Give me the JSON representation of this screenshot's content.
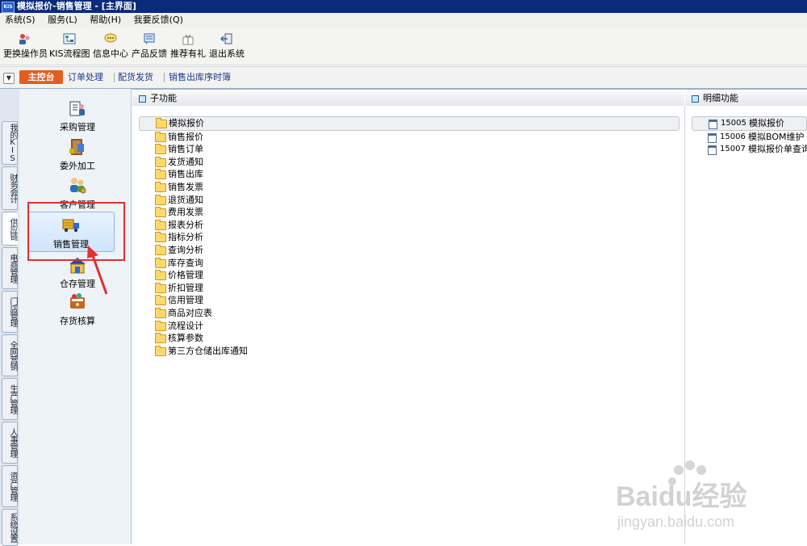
{
  "window": {
    "title": "模拟报价-销售管理 - [主界面]",
    "logo_text": "KIS"
  },
  "menu": [
    "系统(S)",
    "服务(L)",
    "帮助(H)",
    "我要反馈(Q)"
  ],
  "toolbar": [
    {
      "label": "更换操作员",
      "icon": "change-operator-icon"
    },
    {
      "label": "KIS流程图",
      "icon": "flowchart-icon"
    },
    {
      "label": "信息中心",
      "icon": "message-icon"
    },
    {
      "label": "产品反馈",
      "icon": "feedback-icon"
    },
    {
      "label": "推荐有礼",
      "icon": "gift-icon"
    },
    {
      "label": "退出系统",
      "icon": "exit-icon"
    }
  ],
  "nav": {
    "main_tab": "主控台",
    "tabs": [
      "订单处理",
      "配货发货",
      "销售出库序时簿"
    ]
  },
  "vertical_tabs": [
    "我的KIS",
    "财务会计",
    "供应链",
    "电商管理",
    "门店管理",
    "全网营销",
    "生产管理",
    "人事管理",
    "资产管理",
    "系统设置"
  ],
  "modules": [
    {
      "label": "采购管理",
      "icon": "purchase-icon"
    },
    {
      "label": "委外加工",
      "icon": "outsource-icon"
    },
    {
      "label": "客户管理",
      "icon": "customer-icon"
    },
    {
      "label": "销售管理",
      "icon": "truck-icon",
      "selected": true
    },
    {
      "label": "仓存管理",
      "icon": "warehouse-icon"
    },
    {
      "label": "存货核算",
      "icon": "inventory-calc-icon"
    }
  ],
  "sub_panel": {
    "title": "子功能",
    "items": [
      "模拟报价",
      "销售报价",
      "销售订单",
      "发货通知",
      "销售出库",
      "销售发票",
      "退货通知",
      "费用发票",
      "报表分析",
      "指标分析",
      "查询分析",
      "库存查询",
      "价格管理",
      "折扣管理",
      "信用管理",
      "商品对应表",
      "流程设计",
      "核算参数",
      "第三方仓储出库通知"
    ],
    "selected_index": 0
  },
  "detail_panel": {
    "title": "明细功能",
    "items": [
      {
        "code": "15005",
        "name": "模拟报价"
      },
      {
        "code": "15006",
        "name": "模拟BOM维护"
      },
      {
        "code": "15007",
        "name": "模拟报价单查询"
      }
    ]
  },
  "watermark": {
    "brand": "Baidu经验",
    "url": "jingyan.baidu.com"
  },
  "colors": {
    "title_bar": "#0a2a7a",
    "main_tab": "#e35d20",
    "highlight": "#e03030"
  }
}
